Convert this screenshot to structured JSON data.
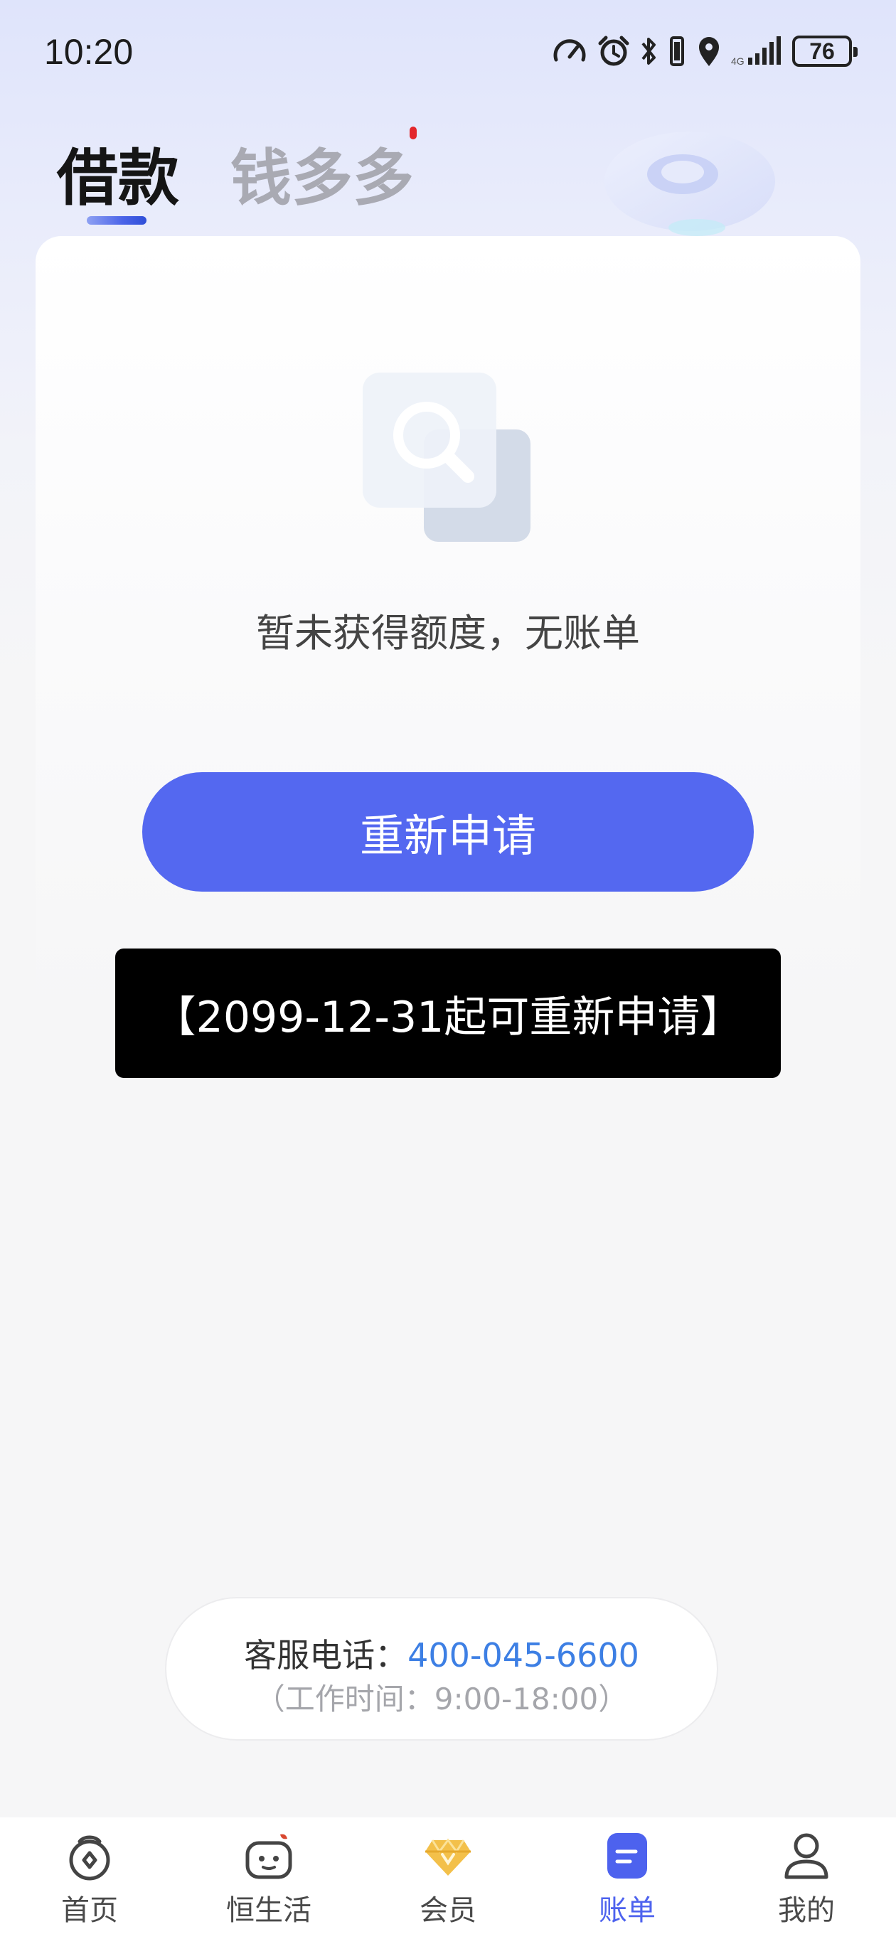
{
  "status_bar": {
    "time": "10:20",
    "battery": "76",
    "icons": [
      "speed-icon",
      "alarm-icon",
      "bluetooth-icon",
      "vibrate-icon",
      "location-icon",
      "signal-icon",
      "battery-icon"
    ]
  },
  "tabs": [
    {
      "label": "借款",
      "active": true
    },
    {
      "label": "钱多多",
      "active": false,
      "has_red_dot": true
    }
  ],
  "main": {
    "empty_text": "暂未获得额度，无账单",
    "reapply_button": "重新申请",
    "notice": "【2099-12-31起可重新申请】"
  },
  "service": {
    "label": "客服电话：",
    "phone": "400-045-6600",
    "hours": "（工作时间：9:00-18:00）"
  },
  "bottom_nav": [
    {
      "label": "首页",
      "icon": "home-bag-icon",
      "active": false
    },
    {
      "label": "恒生活",
      "icon": "life-robot-icon",
      "active": false
    },
    {
      "label": "会员",
      "icon": "vip-diamond-icon",
      "active": false
    },
    {
      "label": "账单",
      "icon": "bill-icon",
      "active": true
    },
    {
      "label": "我的",
      "icon": "profile-icon",
      "active": false
    }
  ],
  "colors": {
    "accent": "#5468f0",
    "active_nav": "#4d62ee",
    "phone_link": "#3d7fe4",
    "red_dot": "#e3262b"
  }
}
